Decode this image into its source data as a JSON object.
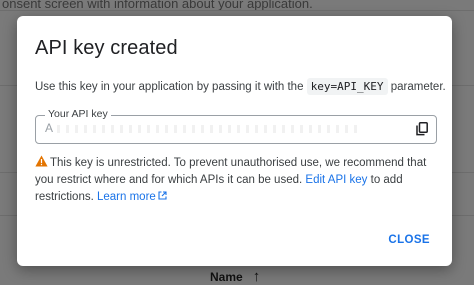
{
  "background": {
    "top_text": "onsent screen with information about your application.",
    "footer_label": "Name",
    "footer_sort_icon": "arrow-up-icon"
  },
  "dialog": {
    "title": "API key created",
    "description_before": "Use this key in your application by passing it with the",
    "description_code": "key=API_KEY",
    "description_after": "parameter.",
    "field_label": "Your API key",
    "field_value_prefix": "A",
    "copy_icon": "copy-icon",
    "warning_icon": "warning-triangle-icon",
    "warning_text": "This key is unrestricted. To prevent unauthorised use, we recommend that you restrict where and for which APIs it can be used.",
    "edit_link": "Edit API key",
    "warning_mid": "to add restrictions.",
    "learn_more": "Learn more",
    "external_icon": "open-in-new-icon",
    "close_label": "CLOSE"
  },
  "colors": {
    "accent": "#1a73e8",
    "warning": "#e37400",
    "overlay": "#7a7a7a"
  }
}
